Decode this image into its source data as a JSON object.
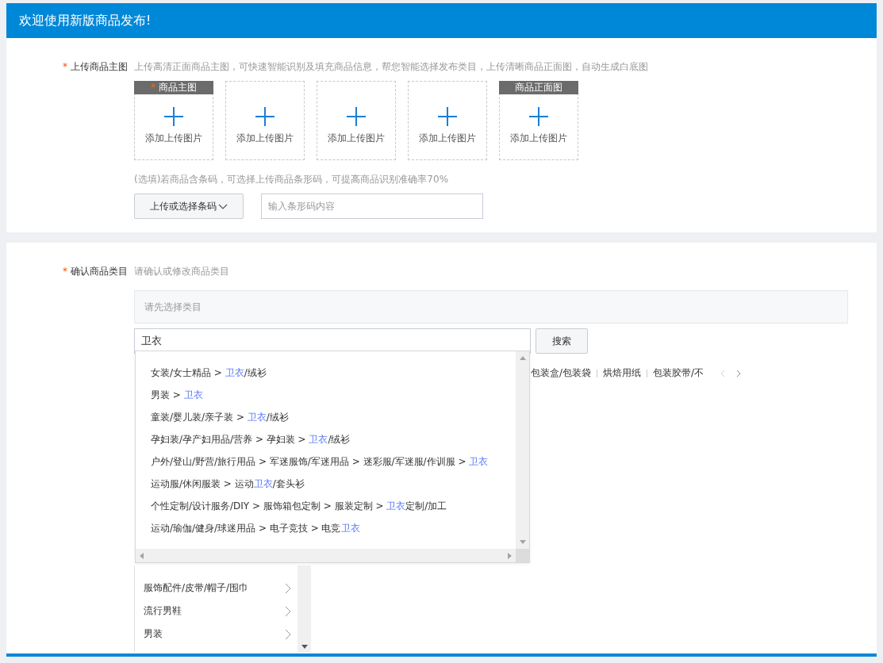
{
  "header": {
    "title": "欢迎使用新版商品发布!"
  },
  "upload": {
    "label": "上传商品主图",
    "required_mark": "*",
    "hint": "上传高清正面商品主图，可快速智能识别及填充商品信息，帮您智能选择发布类目，上传清晰商品正面图，自动生成白底图",
    "slots": [
      {
        "tag": "商品主图",
        "tag_mark": "*",
        "caption": "添加上传图片"
      },
      {
        "caption": "添加上传图片"
      },
      {
        "caption": "添加上传图片"
      },
      {
        "caption": "添加上传图片"
      },
      {
        "tag": "商品正面图",
        "caption": "添加上传图片"
      }
    ],
    "barcode_hint": "(选填)若商品含条码，可选择上传商品条形码，可提高商品识别准确率70%",
    "barcode_button": "上传或选择条码",
    "barcode_placeholder": "输入条形码内容"
  },
  "category": {
    "label": "确认商品类目",
    "required_mark": "*",
    "hint": "请确认或修改商品类目",
    "selected_placeholder": "请先选择类目",
    "search_value": "卫衣",
    "search_button": "搜索",
    "suggestions": [
      [
        {
          "text": "女装/女士精品 > ",
          "highlight": false
        },
        {
          "text": "卫衣",
          "highlight": true
        },
        {
          "text": "/绒衫",
          "highlight": false
        }
      ],
      [
        {
          "text": "男装 > ",
          "highlight": false
        },
        {
          "text": "卫衣",
          "highlight": true
        }
      ],
      [
        {
          "text": "童装/婴儿装/亲子装 > ",
          "highlight": false
        },
        {
          "text": "卫衣",
          "highlight": true
        },
        {
          "text": "/绒衫",
          "highlight": false
        }
      ],
      [
        {
          "text": "孕妇装/孕产妇用品/营养 > 孕妇装 > ",
          "highlight": false
        },
        {
          "text": "卫衣",
          "highlight": true
        },
        {
          "text": "/绒衫",
          "highlight": false
        }
      ],
      [
        {
          "text": "户外/登山/野营/旅行用品 > 军迷服饰/军迷用品 > 迷彩服/军迷服/作训服 > ",
          "highlight": false
        },
        {
          "text": "卫衣",
          "highlight": true
        }
      ],
      [
        {
          "text": "运动服/休闲服装 > 运动",
          "highlight": false
        },
        {
          "text": "卫衣",
          "highlight": true
        },
        {
          "text": "/套头衫",
          "highlight": false
        }
      ],
      [
        {
          "text": "个性定制/设计服务/DIY > 服饰箱包定制 > 服装定制 > ",
          "highlight": false
        },
        {
          "text": "卫衣",
          "highlight": true
        },
        {
          "text": "定制/加工",
          "highlight": false
        }
      ],
      [
        {
          "text": "运动/瑜伽/健身/球迷用品 > 电子竞技 > 电竞",
          "highlight": false
        },
        {
          "text": "卫衣",
          "highlight": true
        }
      ]
    ],
    "hot_tags": [
      "包装盒/包装袋",
      "烘焙用纸",
      "包装胶带/不"
    ],
    "categories": [
      "服饰配件/皮带/帽子/围巾",
      "流行男鞋",
      "男装"
    ]
  }
}
